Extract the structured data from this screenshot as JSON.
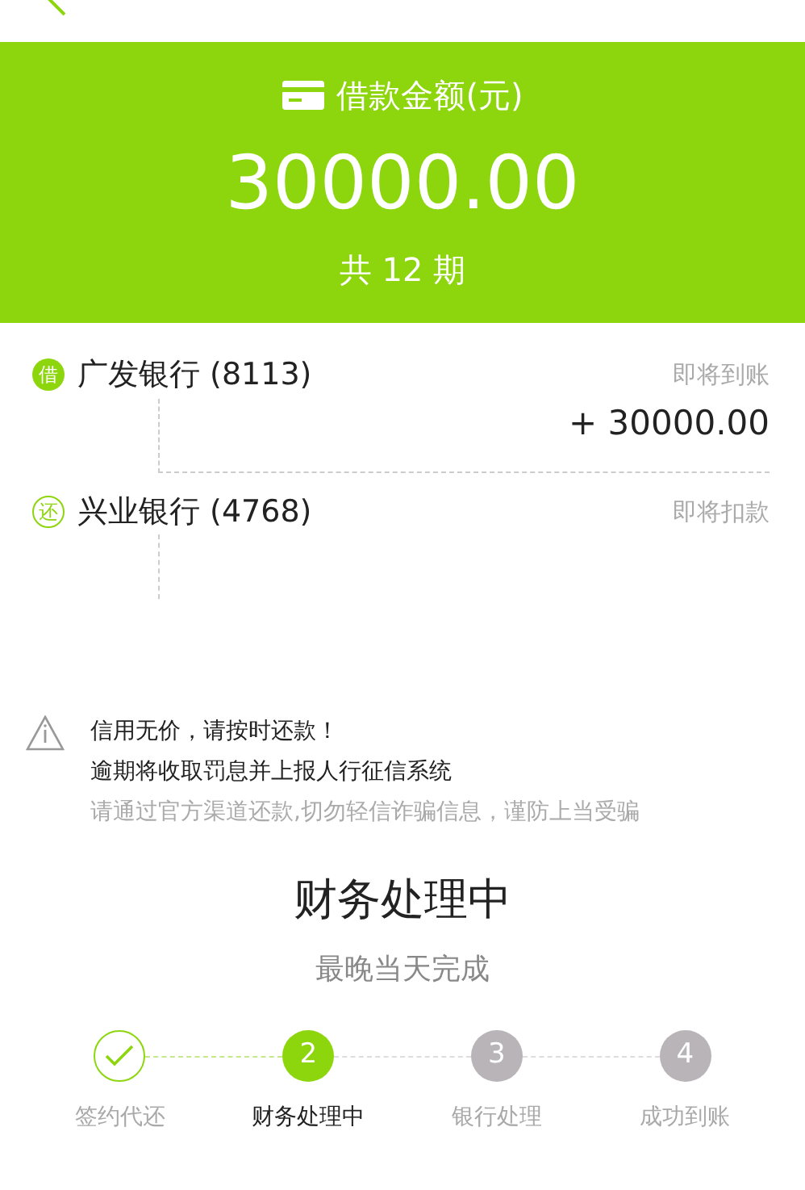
{
  "summary": {
    "label": "借款金额(元)",
    "amount": "30000.00",
    "term": "共 12 期"
  },
  "accounts": [
    {
      "kind": "loan",
      "badge": "借",
      "bank": "广发银行 (8113)",
      "status": "即将到账",
      "amount": "+ 30000.00"
    },
    {
      "kind": "repay",
      "badge": "还",
      "bank": "兴业银行 (4768)",
      "status": "即将扣款"
    }
  ],
  "notice": {
    "lines": [
      {
        "text": "信用无价，请按时还款！",
        "kind": "strong"
      },
      {
        "text": "逾期将收取罚息并上报人行征信系统",
        "kind": "strong"
      },
      {
        "text": "请通过官方渠道还款,切勿轻信诈骗信息，谨防上当受骗",
        "kind": "muted"
      }
    ]
  },
  "progress": {
    "title": "财务处理中",
    "subtitle": "最晚当天完成",
    "steps": [
      {
        "label": "签约代还",
        "done": true,
        "selected": false
      },
      {
        "number": "2",
        "label": "财务处理中",
        "done": false,
        "selected": true
      },
      {
        "number": "3",
        "label": "银行处理",
        "done": false,
        "selected": false
      },
      {
        "number": "4",
        "label": "成功到账",
        "done": false,
        "selected": false
      }
    ]
  }
}
